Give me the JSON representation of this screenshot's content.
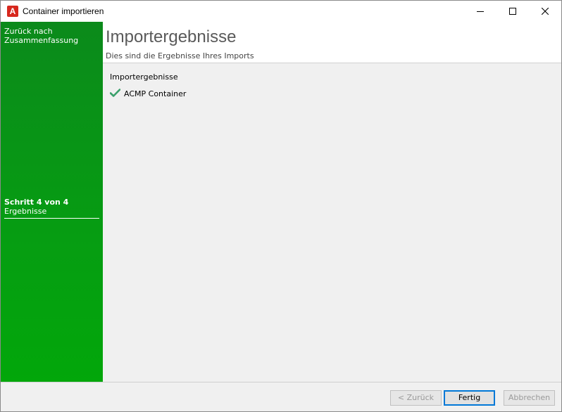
{
  "window": {
    "title": "Container importieren",
    "app_icon_letter": "A",
    "accent_color": "#d7281e"
  },
  "sidebar": {
    "back_link": "Zurück nach Zusammenfassung",
    "step_title": "Schritt 4 von 4",
    "step_name": "Ergebnisse",
    "color": "#069d12"
  },
  "header": {
    "title": "Importergebnisse",
    "subtitle": "Dies sind die Ergebnisse Ihres Imports"
  },
  "content": {
    "section_label": "Importergebnisse",
    "results": [
      {
        "status": "success",
        "icon": "check-icon",
        "label": "ACMP Container"
      }
    ]
  },
  "footer": {
    "back_label": "< Zurück",
    "finish_label": "Fertig",
    "cancel_label": "Abbrechen"
  }
}
